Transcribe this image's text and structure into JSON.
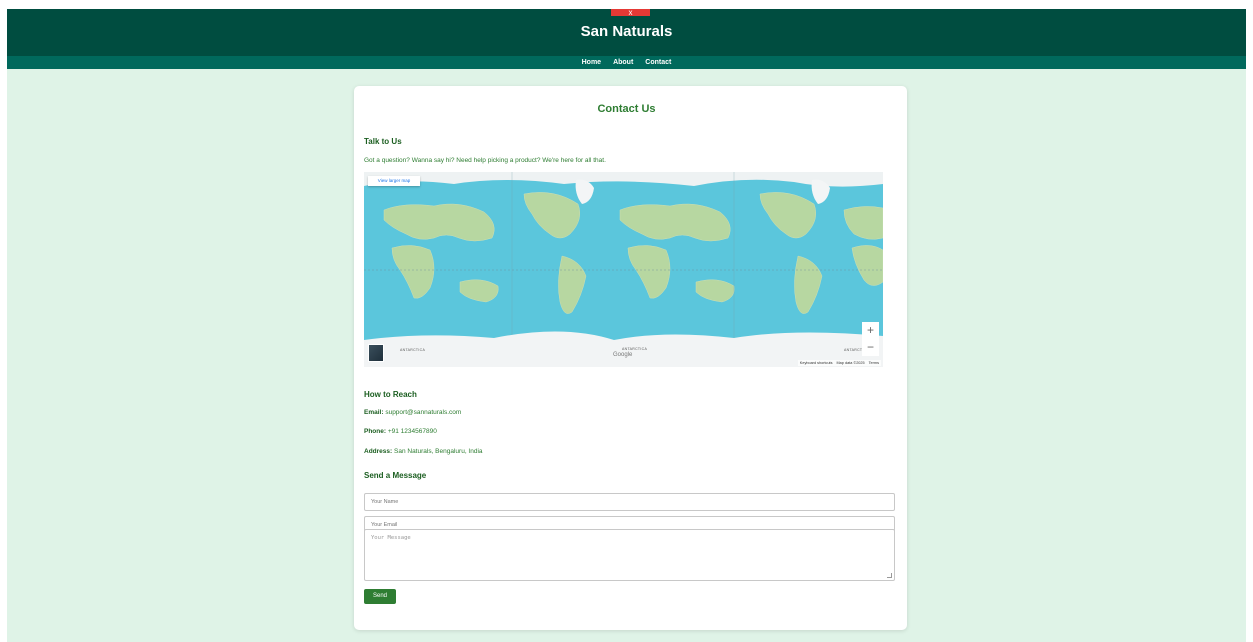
{
  "header": {
    "close_glyph": "x",
    "site_title": "San Naturals"
  },
  "nav": {
    "items": [
      {
        "label": "Home"
      },
      {
        "label": "About"
      },
      {
        "label": "Contact"
      }
    ]
  },
  "contact": {
    "title": "Contact Us",
    "talk_heading": "Talk to Us",
    "talk_text": "Got a question? Wanna say hi? Need help picking a product? We're here for all that.",
    "map": {
      "view_larger_label": "View larger map",
      "zoom_in": "+",
      "zoom_out": "−",
      "google_logo": "Google",
      "labels": {
        "antarctica": "ANTARCTICA",
        "antarctica_cut": "ANTARCT"
      },
      "footer": {
        "shortcuts": "Keyboard shortcuts",
        "map_data": "Map data ©2025",
        "terms": "Terms"
      }
    },
    "reach_heading": "How to Reach",
    "email_label": "Email:",
    "email_value": "support@sannaturals.com",
    "phone_label": "Phone:",
    "phone_value": "+91 1234567890",
    "address_label": "Address:",
    "address_value": "San Naturals, Bengaluru, India",
    "form_heading": "Send a Message",
    "name_placeholder": "Your Name",
    "email_placeholder": "Your Email",
    "message_placeholder": "Your Message",
    "send_label": "Send"
  },
  "colors": {
    "header_bg": "#004d40",
    "nav_bg": "#00695c",
    "page_bg": "#dff3e7",
    "accent_green": "#2e7d32",
    "close_red": "#e53935"
  }
}
